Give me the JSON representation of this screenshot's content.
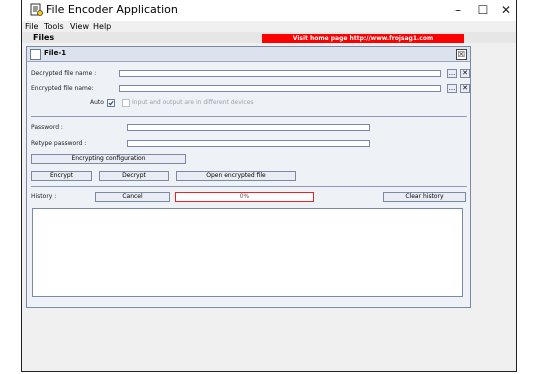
{
  "window": {
    "title": "File Encoder Application",
    "minimize_label": "–",
    "maximize_label": "☐",
    "close_label": "✕"
  },
  "menubar": {
    "items": [
      "File",
      "Tools",
      "View",
      "Help"
    ]
  },
  "tabs": {
    "active": "Files"
  },
  "banner": {
    "text": "Visit home page http://www.frojsag1.com"
  },
  "inner_window": {
    "title": "File-1",
    "close_label": "☒"
  },
  "form": {
    "decrypted_label": "Decrypted file name :",
    "decrypted_value": "",
    "encrypted_label": "Encrypted file name:",
    "encrypted_value": "",
    "browse_label": "...",
    "clear_label": "✕",
    "auto_label": "Auto",
    "auto_checked": true,
    "devices_label": "Input and output are in different devices",
    "password_label": "Password :",
    "password_value": "",
    "retype_label": "Retype password :",
    "retype_value": ""
  },
  "buttons": {
    "encrypting_config": "Encrypting configuration",
    "encrypt": "Encrypt",
    "decrypt": "Decrypt",
    "open_encrypted": "Open encrypted file",
    "cancel": "Cancel",
    "clear_history": "Clear history"
  },
  "history": {
    "label": "History :",
    "progress_text": "0%",
    "progress": 0
  },
  "colors": {
    "banner": "#ff0000",
    "progress_border": "#ee2222"
  }
}
